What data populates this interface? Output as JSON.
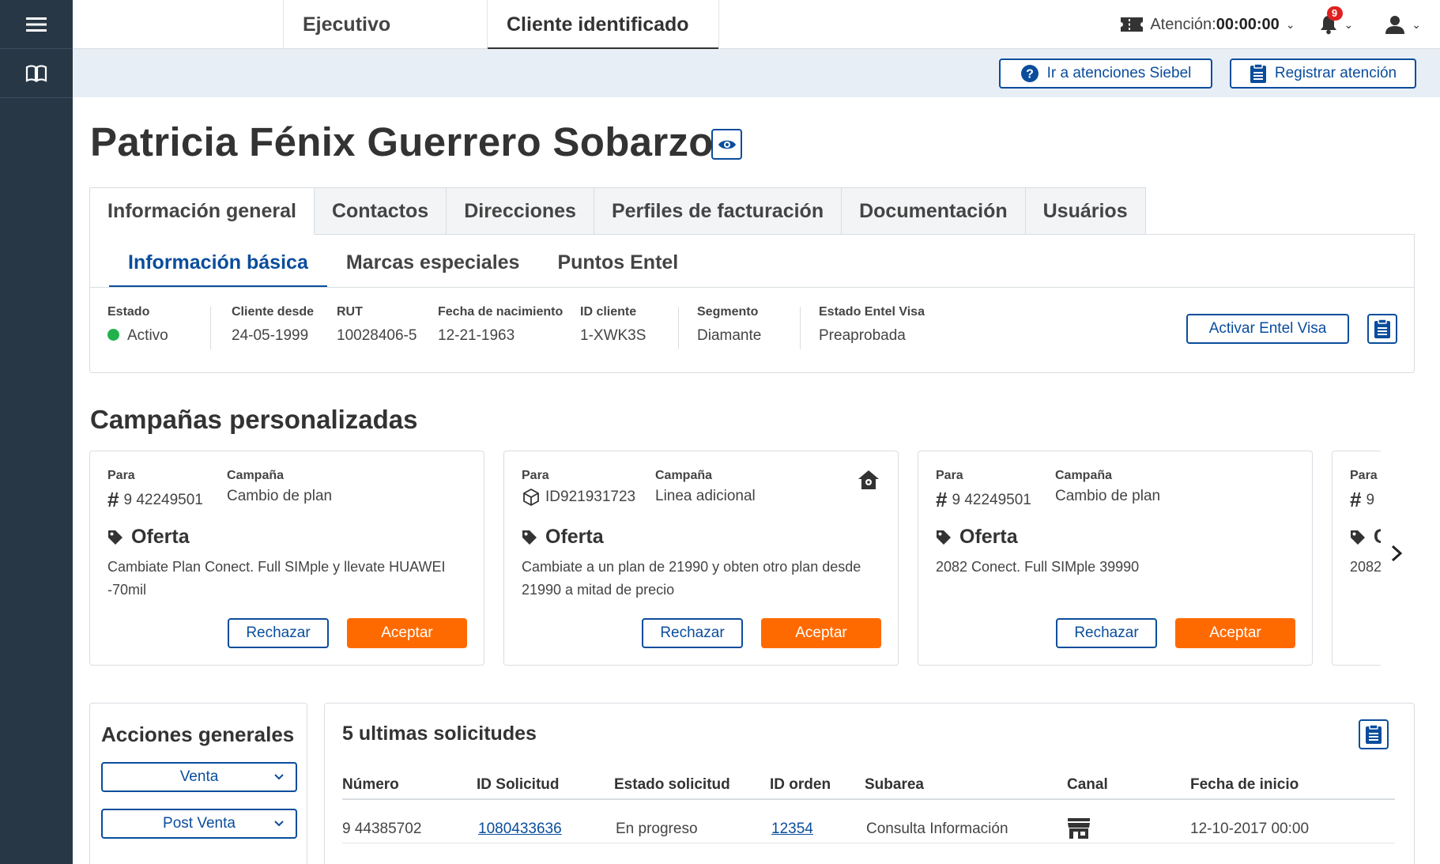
{
  "topbar": {
    "tabs": [
      "Ejecutivo",
      "Cliente identificado"
    ],
    "atencion_label": "Atención:",
    "atencion_time": "00:00:00",
    "notifications_count": "9"
  },
  "actionbar": {
    "siebel_label": "Ir a atenciones Siebel",
    "registrar_label": "Registrar atención"
  },
  "client": {
    "name": "Patricia Fénix Guerrero Sobarzo"
  },
  "main_tabs": [
    "Información general",
    "Contactos",
    "Direcciones",
    "Perfiles de facturación",
    "Documentación",
    "Usuários"
  ],
  "sub_tabs": [
    "Información básica",
    "Marcas especiales",
    "Puntos Entel"
  ],
  "info": {
    "estado_k": "Estado",
    "estado_v": "Activo",
    "cliente_desde_k": "Cliente desde",
    "cliente_desde_v": "24-05-1999",
    "rut_k": "RUT",
    "rut_v": "10028406-5",
    "fecha_nac_k": "Fecha de nacimiento",
    "fecha_nac_v": "12-21-1963",
    "id_cliente_k": "ID cliente",
    "id_cliente_v": "1-XWK3S",
    "segmento_k": "Segmento",
    "segmento_v": "Diamante",
    "visa_k": "Estado Entel Visa",
    "visa_v": "Preaprobada",
    "activar_label": "Activar Entel Visa",
    "status_color": "#21b24b"
  },
  "campaigns": {
    "title": "Campañas personalizadas",
    "para_label": "Para",
    "campana_label": "Campaña",
    "oferta_label": "Oferta",
    "rechazar_label": "Rechazar",
    "aceptar_label": "Aceptar",
    "accent_color": "#ff6a00",
    "cards": [
      {
        "para": "9 42249501",
        "para_icon": "hash-icon",
        "campana": "Cambio de plan",
        "desc": "Cambiate Plan Conect. Full SIMple y llevate HUAWEI -70mil"
      },
      {
        "para": "ID921931723",
        "para_icon": "package-icon",
        "campana": "Linea adicional",
        "desc": "Cambiate a un plan de 21990 y obten otro plan desde 21990 a mitad de precio"
      },
      {
        "para": "9 42249501",
        "para_icon": "hash-icon",
        "campana": "Cambio de plan",
        "desc": "2082 Conect. Full SIMple 39990"
      },
      {
        "para": "9",
        "para_icon": "hash-icon",
        "oferta_partial": "C",
        "desc": "2082"
      }
    ]
  },
  "acciones": {
    "title": "Acciones generales",
    "venta": "Venta",
    "post_venta": "Post Venta"
  },
  "solicitudes": {
    "title": "5 ultimas solicitudes",
    "headers": [
      "Número",
      "ID Solicitud",
      "Estado solicitud",
      "ID orden",
      "Subarea",
      "Canal",
      "Fecha de inicio"
    ],
    "rows": [
      {
        "numero": "9 44385702",
        "id_solicitud": "1080433636",
        "estado": "En progreso",
        "id_orden": "12354",
        "subarea": "Consulta Información",
        "canal_icon": "store-icon",
        "fecha": "12-10-2017 00:00"
      }
    ]
  },
  "colors": {
    "primary": "#0a4d9c",
    "rail": "#283746"
  }
}
